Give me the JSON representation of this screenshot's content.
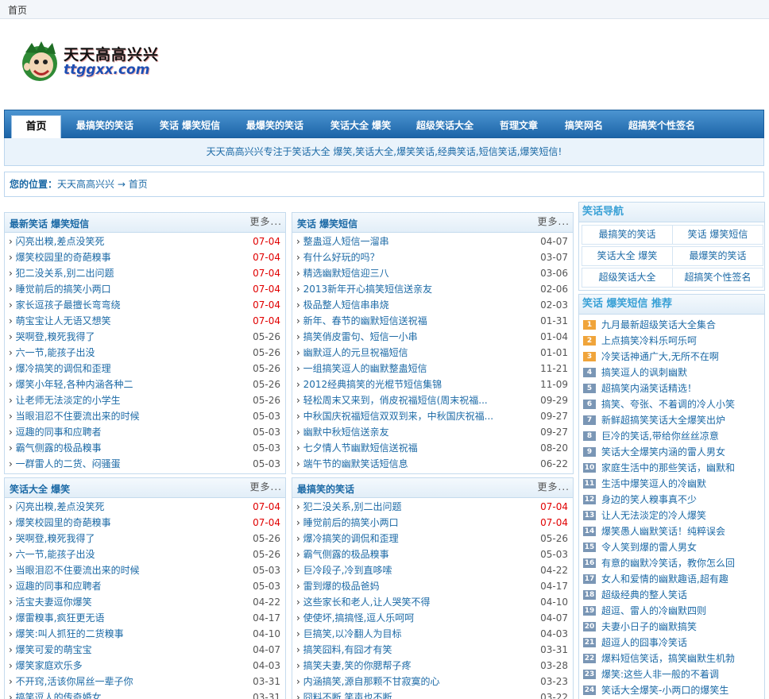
{
  "topbar": {
    "home": "首页"
  },
  "logo": {
    "cn": "天天高高兴兴",
    "en": "ttggxx.com"
  },
  "nav": {
    "home": "首页",
    "items": [
      "最搞笑的笑话",
      "笑话 爆笑短信",
      "最爆笑的笑话",
      "笑话大全 爆笑",
      "超级笑话大全",
      "哲理文章",
      "搞笑网名",
      "超搞笑个性签名"
    ]
  },
  "slogan": "天天高高兴兴专注于笑话大全 爆笑,笑话大全,爆笑笑话,经典笑话,短信笑话,爆笑短信!",
  "crumb": {
    "label": "您的位置：",
    "site": "天天高高兴兴",
    "arrow": "→",
    "page": "首页"
  },
  "boxes": {
    "latest": {
      "title": "最新笑话 爆笑短信",
      "more": "更多...",
      "items": [
        {
          "t": "闪亮出糗,差点没笑死",
          "d": "07-04",
          "red": true
        },
        {
          "t": "爆笑校园里的奇葩糗事",
          "d": "07-04",
          "red": true
        },
        {
          "t": "犯二没关系,别二出问题",
          "d": "07-04",
          "red": true
        },
        {
          "t": "睡觉前后的搞笑小两口",
          "d": "07-04",
          "red": true
        },
        {
          "t": "家长逗孩子最擅长弯弯绕",
          "d": "07-04",
          "red": true
        },
        {
          "t": "萌宝宝让人无语又想笑",
          "d": "07-04",
          "red": true
        },
        {
          "t": "哭啊登,糗死我得了",
          "d": "05-26",
          "red": false
        },
        {
          "t": "六一节,能孩子出没",
          "d": "05-26",
          "red": false
        },
        {
          "t": "爆冷搞笑的调侃和歪理",
          "d": "05-26",
          "red": false
        },
        {
          "t": "爆笑小年轻,各种内涵各种二",
          "d": "05-26",
          "red": false
        },
        {
          "t": "让老师无法淡定的小学生",
          "d": "05-26",
          "red": false
        },
        {
          "t": "当眼泪忍不住要流出来的时候",
          "d": "05-03",
          "red": false
        },
        {
          "t": "逗趣的同事和应聘者",
          "d": "05-03",
          "red": false
        },
        {
          "t": "霸气侧露的极品糗事",
          "d": "05-03",
          "red": false
        },
        {
          "t": "一群雷人的二货、闷骚蛋",
          "d": "05-03",
          "red": false
        }
      ]
    },
    "sms": {
      "title": "笑话 爆笑短信",
      "more": "更多...",
      "items": [
        {
          "t": "整蛊逗人短信一溜串",
          "d": "04-07",
          "red": false
        },
        {
          "t": "有什么好玩的吗？",
          "d": "03-07",
          "red": false
        },
        {
          "t": "精选幽默短信迎三八",
          "d": "03-06",
          "red": false
        },
        {
          "t": "2013新年开心搞笑短信送亲友",
          "d": "02-06",
          "red": false
        },
        {
          "t": "极品整人短信串串烧",
          "d": "02-03",
          "red": false
        },
        {
          "t": "新年、春节的幽默短信送祝福",
          "d": "01-31",
          "red": false
        },
        {
          "t": "搞笑俏皮雷句、短信一小串",
          "d": "01-04",
          "red": false
        },
        {
          "t": "幽默逗人的元旦祝福短信",
          "d": "01-01",
          "red": false
        },
        {
          "t": "一组搞笑逗人的幽默整蛊短信",
          "d": "11-21",
          "red": false
        },
        {
          "t": "2012经典搞笑的光棍节短信集锦",
          "d": "11-09",
          "red": false
        },
        {
          "t": "轻松周末又来到，俏皮祝福短信(周末祝福...",
          "d": "09-29",
          "red": false
        },
        {
          "t": "中秋国庆祝福短信双双到来，中秋国庆祝福...",
          "d": "09-27",
          "red": false
        },
        {
          "t": "幽默中秋短信送亲友",
          "d": "09-27",
          "red": false
        },
        {
          "t": "七夕情人节幽默短信送祝福",
          "d": "08-20",
          "red": false
        },
        {
          "t": "端午节的幽默笑话短信息",
          "d": "06-22",
          "red": false
        }
      ]
    },
    "daquan": {
      "title": "笑话大全 爆笑",
      "more": "更多...",
      "items": [
        {
          "t": "闪亮出糗,差点没笑死",
          "d": "07-04",
          "red": true
        },
        {
          "t": "爆笑校园里的奇葩糗事",
          "d": "07-04",
          "red": true
        },
        {
          "t": "哭啊登,糗死我得了",
          "d": "05-26",
          "red": false
        },
        {
          "t": "六一节,能孩子出没",
          "d": "05-26",
          "red": false
        },
        {
          "t": "当眼泪忍不住要流出来的时候",
          "d": "05-03",
          "red": false
        },
        {
          "t": "逗趣的同事和应聘者",
          "d": "05-03",
          "red": false
        },
        {
          "t": "活宝夫妻逗你爆笑",
          "d": "04-22",
          "red": false
        },
        {
          "t": "爆雷糗事,疯狂更无语",
          "d": "04-17",
          "red": false
        },
        {
          "t": "爆笑:叫人抓狂的二货糗事",
          "d": "04-10",
          "red": false
        },
        {
          "t": "爆笑可爱的萌宝宝",
          "d": "04-07",
          "red": false
        },
        {
          "t": "爆笑家庭欢乐多",
          "d": "04-03",
          "red": false
        },
        {
          "t": "不开窍,活该你屌丝一辈子你",
          "d": "03-31",
          "red": false
        },
        {
          "t": "搞笑逗人的传奇婚女",
          "d": "03-31",
          "red": false
        }
      ]
    },
    "funniest": {
      "title": "最搞笑的笑话",
      "more": "更多...",
      "items": [
        {
          "t": "犯二没关系,别二出问题",
          "d": "07-04",
          "red": true
        },
        {
          "t": "睡觉前后的搞笑小两口",
          "d": "07-04",
          "red": true
        },
        {
          "t": "爆冷搞笑的调侃和歪理",
          "d": "05-26",
          "red": false
        },
        {
          "t": "霸气侧露的极品糗事",
          "d": "05-03",
          "red": false
        },
        {
          "t": "巨冷段子,冷到直哆嗦",
          "d": "04-22",
          "red": false
        },
        {
          "t": "雷到爆的极品爸妈",
          "d": "04-17",
          "red": false
        },
        {
          "t": "这些家长和老人,让人哭笑不得",
          "d": "04-10",
          "red": false
        },
        {
          "t": "使使坏,搞搞怪,逗人乐呵呵",
          "d": "04-07",
          "red": false
        },
        {
          "t": "巨搞笑,以冷翻人为目标",
          "d": "04-03",
          "red": false
        },
        {
          "t": "搞笑囧料,有囧才有笑",
          "d": "03-31",
          "red": false
        },
        {
          "t": "搞笑夫妻,笑的你腮帮子疼",
          "d": "03-28",
          "red": false
        },
        {
          "t": "内涵搞笑,源自那颗不甘寂寞的心",
          "d": "03-23",
          "red": false
        },
        {
          "t": "囧料不断,笑声也不断",
          "d": "03-22",
          "red": false
        }
      ]
    }
  },
  "side_nav": {
    "title": "笑话导航",
    "links": [
      "最搞笑的笑话",
      "笑话 爆笑短信",
      "笑话大全 爆笑",
      "最爆笑的笑话",
      "超级笑话大全",
      "超搞笑个性签名"
    ]
  },
  "side_rank": {
    "title": "笑话 爆笑短信 推荐",
    "items": [
      {
        "n": "1",
        "t": "九月最新超级笑话大全集合"
      },
      {
        "n": "2",
        "t": "上点搞笑冷料乐呵乐呵"
      },
      {
        "n": "3",
        "t": "冷笑话神通广大,无所不在啊"
      },
      {
        "n": "4",
        "t": "搞笑逗人的讽刺幽默"
      },
      {
        "n": "5",
        "t": "超搞笑内涵笑话精选！"
      },
      {
        "n": "6",
        "t": "搞笑、夸张、不着调的冷人小笑"
      },
      {
        "n": "7",
        "t": "新鲜超搞笑笑话大全爆笑出炉"
      },
      {
        "n": "8",
        "t": "巨冷的笑话,带给你丝丝凉意"
      },
      {
        "n": "9",
        "t": "笑话大全爆笑内涵的雷人男女"
      },
      {
        "n": "10",
        "t": "家庭生活中的那些笑话，幽默和"
      },
      {
        "n": "11",
        "t": "生活中爆笑逗人的冷幽默"
      },
      {
        "n": "12",
        "t": "身边的笑人糗事真不少"
      },
      {
        "n": "13",
        "t": "让人无法淡定的冷人爆笑"
      },
      {
        "n": "14",
        "t": "爆笑愚人幽默笑话！纯粹误会"
      },
      {
        "n": "15",
        "t": "令人笑到爆的雷人男女"
      },
      {
        "n": "16",
        "t": "有意的幽默冷笑话，教你怎么回"
      },
      {
        "n": "17",
        "t": "女人和爱情的幽默趣语,超有趣"
      },
      {
        "n": "18",
        "t": "超级经典的整人笑话"
      },
      {
        "n": "19",
        "t": "超逗、雷人的冷幽默四则"
      },
      {
        "n": "20",
        "t": "夫妻小日子的幽默搞笑"
      },
      {
        "n": "21",
        "t": "超逗人的囧事冷笑话"
      },
      {
        "n": "22",
        "t": "爆料短信笑话，搞笑幽默生机勃"
      },
      {
        "n": "23",
        "t": "爆笑:这些人非一般的不着调"
      },
      {
        "n": "24",
        "t": "笑话大全爆笑-小两口的爆笑生"
      }
    ]
  }
}
